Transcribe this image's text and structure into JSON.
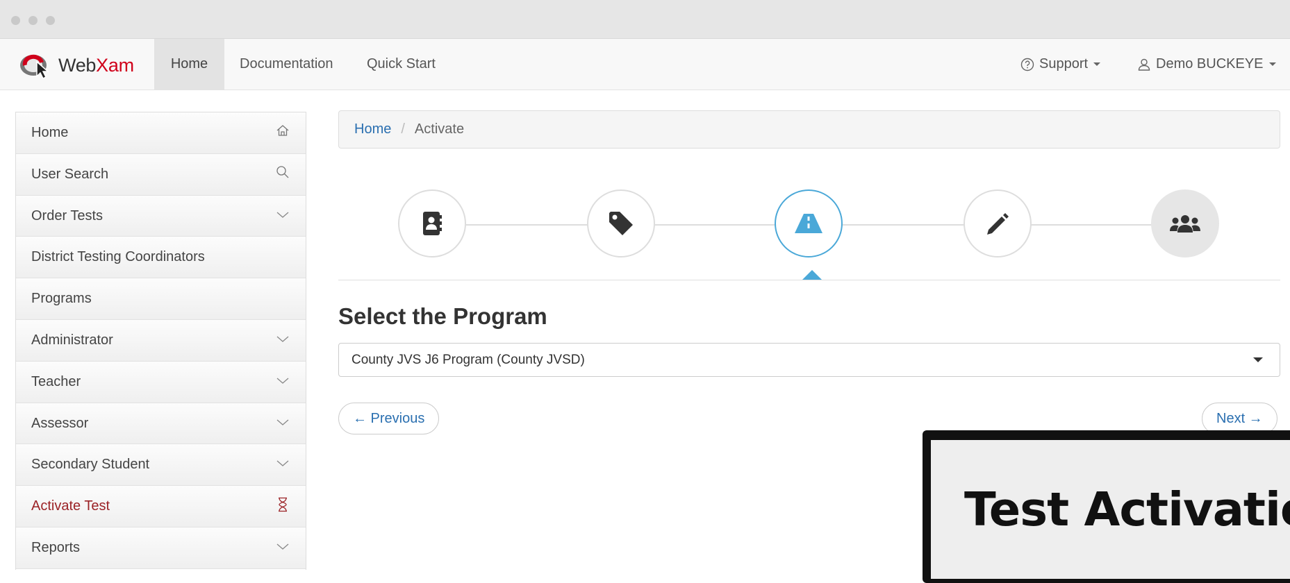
{
  "brand": {
    "prefix": "Web",
    "accent": "Xam"
  },
  "nav": {
    "links": [
      {
        "label": "Home"
      },
      {
        "label": "Documentation"
      },
      {
        "label": "Quick Start"
      }
    ],
    "support_label": "Support",
    "user_label": "Demo BUCKEYE"
  },
  "sidebar": {
    "items": [
      {
        "label": "Home",
        "icon": "home-icon"
      },
      {
        "label": "User Search",
        "icon": "search-icon"
      },
      {
        "label": "Order Tests",
        "icon": "chevron-down-icon"
      },
      {
        "label": "District Testing Coordinators",
        "icon": ""
      },
      {
        "label": "Programs",
        "icon": ""
      },
      {
        "label": "Administrator",
        "icon": "chevron-down-icon"
      },
      {
        "label": "Teacher",
        "icon": "chevron-down-icon"
      },
      {
        "label": "Assessor",
        "icon": "chevron-down-icon"
      },
      {
        "label": "Secondary Student",
        "icon": "chevron-down-icon"
      },
      {
        "label": "Activate Test",
        "icon": "hourglass-icon"
      },
      {
        "label": "Reports",
        "icon": "chevron-down-icon"
      }
    ]
  },
  "breadcrumb": {
    "home": "Home",
    "separator": "/",
    "current": "Activate"
  },
  "steps": [
    {
      "icon": "address-book-icon",
      "state": "done"
    },
    {
      "icon": "tag-icon",
      "state": "done"
    },
    {
      "icon": "road-icon",
      "state": "current"
    },
    {
      "icon": "pencil-icon",
      "state": "todo"
    },
    {
      "icon": "users-icon",
      "state": "todo"
    }
  ],
  "program": {
    "title": "Select the Program",
    "selected": "County JVS J6 Program (County JVSD)"
  },
  "buttons": {
    "previous": "← Previous",
    "next": "Next →"
  },
  "overlay": {
    "caption": "Test Activation"
  },
  "colors": {
    "accent": "#4aa8d8",
    "link": "#2a6fb0",
    "active_item": "#9b2226",
    "brand_red": "#d0021b"
  }
}
